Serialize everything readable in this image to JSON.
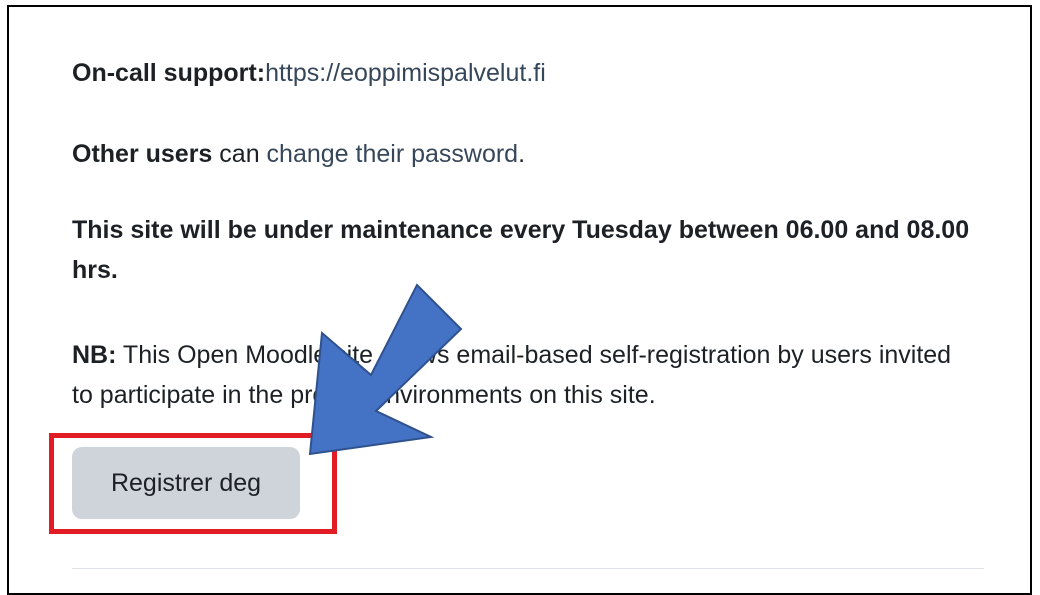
{
  "support": {
    "label": "On-call support:",
    "link": "https://eoppimispalvelut.fi"
  },
  "password": {
    "bold": "Other users",
    "middle": " can ",
    "link": "change their password",
    "end": "."
  },
  "maintenance": {
    "text": "This site will be under maintenance every Tuesday between 06.00 and 08.00 hrs."
  },
  "note": {
    "bold": "NB:",
    "text": " This Open Moodle site allows email-based self-registration by users invited to participate in the project environments on this site."
  },
  "register_button": {
    "label": "Registrer deg"
  },
  "colors": {
    "highlight": "#e21c25",
    "arrow": "#4472c4",
    "button": "#ced4da"
  }
}
